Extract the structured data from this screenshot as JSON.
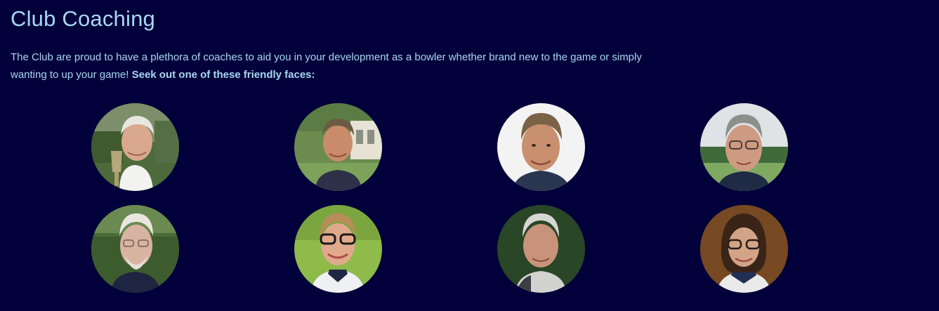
{
  "page": {
    "title": "Club Coaching",
    "intro_text": "The Club are proud to have a plethora of coaches to aid you in your development as a bowler whether brand new to the game or simply wanting to up your game! ",
    "intro_emphasis": "Seek out one of these friendly faces:"
  },
  "theme": {
    "background": "#02003a",
    "text": "#a9d7f1"
  },
  "coaches": [
    {
      "photo": "coach-portrait-1"
    },
    {
      "photo": "coach-portrait-2"
    },
    {
      "photo": "coach-portrait-3"
    },
    {
      "photo": "coach-portrait-4"
    },
    {
      "photo": "coach-portrait-5"
    },
    {
      "photo": "coach-portrait-6"
    },
    {
      "photo": "coach-portrait-7"
    },
    {
      "photo": "coach-portrait-8"
    }
  ]
}
